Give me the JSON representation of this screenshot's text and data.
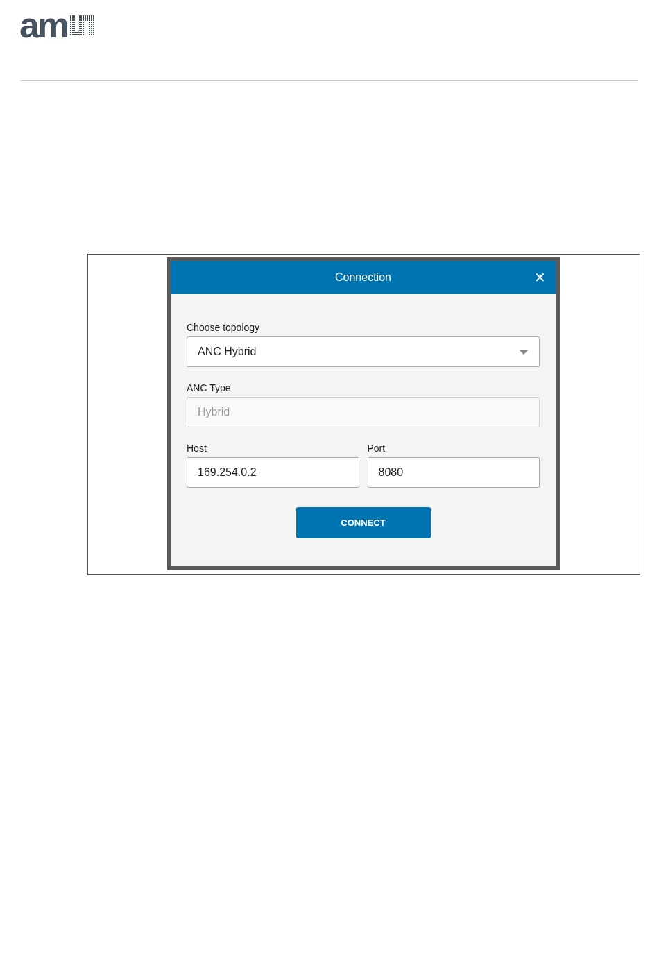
{
  "logo": {
    "text": "am"
  },
  "dialog": {
    "title": "Connection",
    "close": "✕",
    "fields": [
      {
        "kind": "select",
        "label": "Choose topology",
        "value": "ANC Hybrid",
        "disabled": false
      },
      {
        "kind": "text",
        "label": "ANC Type",
        "placeholder": "Hybrid",
        "disabled": true
      }
    ],
    "host": {
      "label": "Host",
      "value": "169.254.0.2"
    },
    "port": {
      "label": "Port",
      "value": "8080"
    },
    "button": "CONNECT"
  }
}
